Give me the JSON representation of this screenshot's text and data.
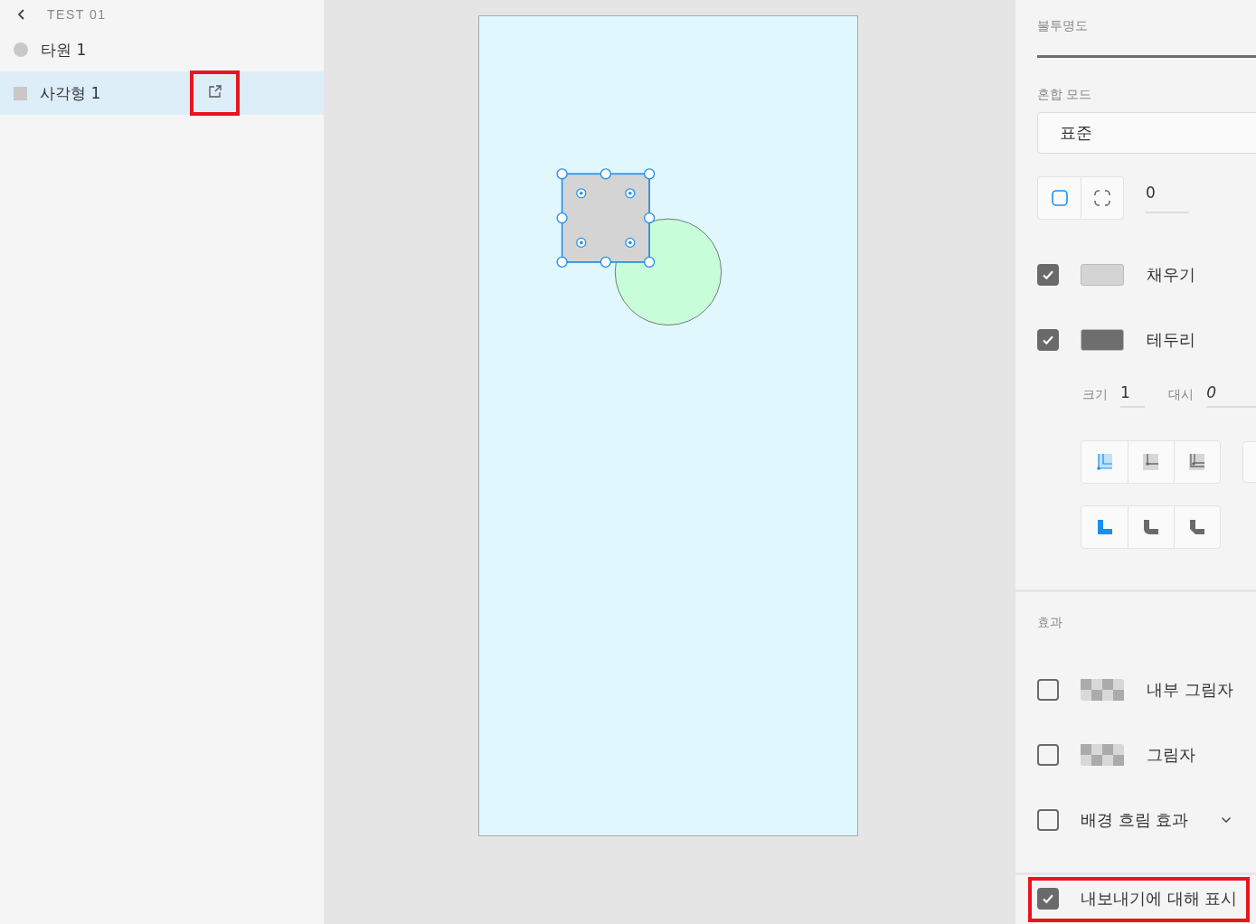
{
  "layers": {
    "title": "TEST 01",
    "items": [
      {
        "kind": "ellipse",
        "name": "타원 1",
        "selected": false,
        "highlighted": false
      },
      {
        "kind": "rectangle",
        "name": "사각형 1",
        "selected": true,
        "highlighted": true
      }
    ]
  },
  "canvas": {
    "shapes": [
      {
        "kind": "ellipse",
        "color": "#c8fdd9",
        "selected": false
      },
      {
        "kind": "rectangle",
        "color": "#d4d4d4",
        "selected": true
      }
    ]
  },
  "properties": {
    "opacity": {
      "label": "불투명도",
      "level": 1
    },
    "blend_mode": {
      "label": "혼합 모드",
      "value": "표준"
    },
    "corners": {
      "buttons": [
        {
          "kind": "uniform",
          "selected": true
        },
        {
          "kind": "individual",
          "selected": false
        }
      ],
      "radius": "0"
    },
    "fill": {
      "label": "채우기",
      "checked": true,
      "color": "#d4d4d4"
    },
    "border": {
      "label": "테두리",
      "checked": true,
      "color": "#6e6e6e",
      "size_label": "크기",
      "size": "1",
      "dash_label": "대시",
      "dash": "0"
    },
    "stroke_align": [
      {
        "kind": "inside",
        "selected": true
      },
      {
        "kind": "center",
        "selected": false
      },
      {
        "kind": "outside",
        "selected": false
      }
    ],
    "joins": [
      {
        "kind": "miter",
        "selected": true
      },
      {
        "kind": "round",
        "selected": false
      },
      {
        "kind": "bevel",
        "selected": false
      }
    ],
    "effects": {
      "label": "효과",
      "items": [
        {
          "kind": "swatch",
          "label": "내부 그림자",
          "checked": false
        },
        {
          "kind": "swatch",
          "label": "그림자",
          "checked": false
        },
        {
          "kind": "expandable",
          "label": "배경 흐림 효과",
          "checked": false
        }
      ]
    },
    "export": {
      "label": "내보내기에 대해 표시",
      "checked": true,
      "highlighted": true
    }
  }
}
